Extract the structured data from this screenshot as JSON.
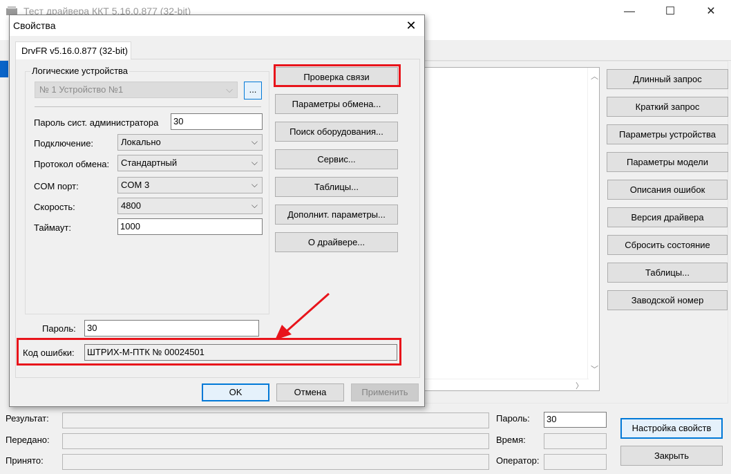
{
  "main_window": {
    "title": "Тест драйвера ККТ 5.16.0.877 (32-bit)",
    "minimize_glyph": "—",
    "maximize_glyph": "☐",
    "close_glyph": "✕"
  },
  "right_buttons": [
    {
      "label": "Длинный запрос"
    },
    {
      "label": "Краткий запрос"
    },
    {
      "label": "Параметры устройства"
    },
    {
      "label": "Параметры модели"
    },
    {
      "label": "Описания ошибок"
    },
    {
      "label": "Версия драйвера"
    },
    {
      "label": "Сбросить состояние"
    },
    {
      "label": "Таблицы..."
    },
    {
      "label": "Заводской номер"
    }
  ],
  "status": {
    "result_label": "Результат:",
    "sent_label": "Передано:",
    "received_label": "Принято:",
    "password_label": "Пароль:",
    "password_value": "30",
    "time_label": "Время:",
    "operator_label": "Оператор:",
    "settings_button": "Настройка свойств",
    "close_button": "Закрыть"
  },
  "dialog": {
    "title": "Свойства",
    "close_glyph": "✕",
    "tab": "DrvFR v5.16.0.877 (32-bit)",
    "group_label": "Логические устройства",
    "device_select": "№ 1 Устройство №1",
    "device_dots": "...",
    "fields": {
      "admin_password_label": "Пароль сист. администратора",
      "admin_password_value": "30",
      "connection_label": "Подключение:",
      "connection_value": "Локально",
      "protocol_label": "Протокол обмена:",
      "protocol_value": "Стандартный",
      "com_label": "COM порт:",
      "com_value": "COM 3",
      "speed_label": "Скорость:",
      "speed_value": "4800",
      "timeout_label": "Таймаут:",
      "timeout_value": "1000"
    },
    "buttons": [
      {
        "label": "Проверка связи"
      },
      {
        "label": "Параметры обмена..."
      },
      {
        "label": "Поиск оборудования..."
      },
      {
        "label": "Сервис..."
      },
      {
        "label": "Таблицы..."
      },
      {
        "label": "Дополнит. параметры..."
      },
      {
        "label": "О драйвере..."
      }
    ],
    "password_label": "Пароль:",
    "password_value": "30",
    "error_label": "Код ошибки:",
    "error_value": "ШТРИХ-М-ПТК № 00024501",
    "ok": "OK",
    "cancel": "Отмена",
    "apply": "Применить"
  },
  "colors": {
    "highlight": "#e8141b",
    "accent": "#0078d7"
  }
}
